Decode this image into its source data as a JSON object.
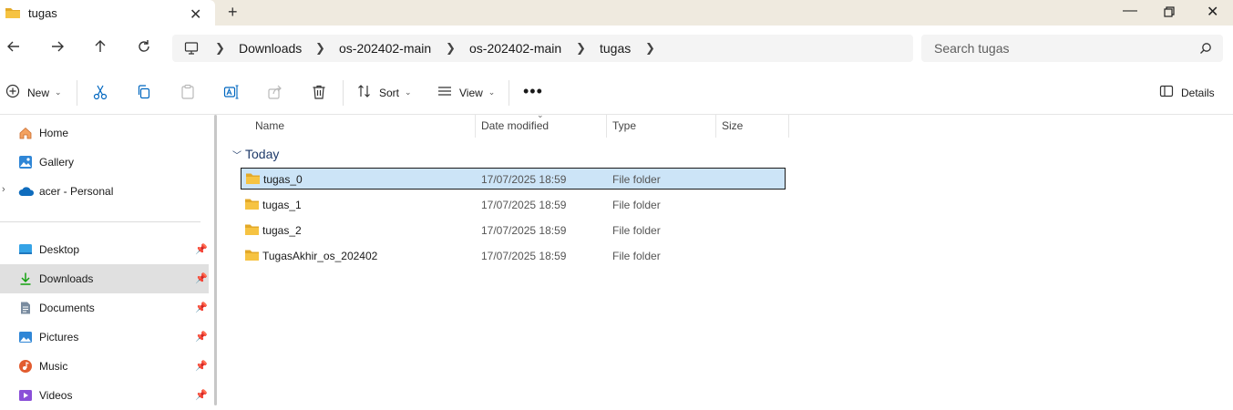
{
  "tab": {
    "title": "tugas",
    "close_icon": "close-icon",
    "new_tab_icon": "plus-icon"
  },
  "window": {
    "minimize": "minimize-icon",
    "maximize": "maximize-icon",
    "close": "close-icon"
  },
  "nav": {
    "back": "back-arrow-icon",
    "forward": "forward-arrow-icon",
    "up": "up-arrow-icon",
    "refresh": "refresh-icon"
  },
  "breadcrumb": {
    "root_icon": "computer-icon",
    "items": [
      "Downloads",
      "os-202402-main",
      "os-202402-main",
      "tugas"
    ]
  },
  "search": {
    "placeholder": "Search tugas"
  },
  "commands": {
    "new": "New",
    "cut": "cut-icon",
    "copy": "copy-icon",
    "paste": "paste-icon",
    "rename": "rename-icon",
    "share": "share-icon",
    "delete": "delete-icon",
    "sort": "Sort",
    "view": "View",
    "more": "more-icon",
    "details": "Details"
  },
  "sidebar": {
    "top_items": [
      {
        "label": "Home",
        "icon": "home-icon"
      },
      {
        "label": "Gallery",
        "icon": "gallery-icon"
      },
      {
        "label": "acer - Personal",
        "icon": "cloud-icon"
      }
    ],
    "pinned_items": [
      {
        "label": "Desktop",
        "icon": "desktop-icon"
      },
      {
        "label": "Downloads",
        "icon": "download-icon"
      },
      {
        "label": "Documents",
        "icon": "documents-icon"
      },
      {
        "label": "Pictures",
        "icon": "pictures-icon"
      },
      {
        "label": "Music",
        "icon": "music-icon"
      },
      {
        "label": "Videos",
        "icon": "videos-icon"
      }
    ],
    "active": "Downloads"
  },
  "columns": [
    "Name",
    "Date modified",
    "Type",
    "Size"
  ],
  "group": {
    "label": "Today"
  },
  "rows": [
    {
      "name": "tugas_0",
      "date": "17/07/2025 18:59",
      "type": "File folder",
      "selected": true
    },
    {
      "name": "tugas_1",
      "date": "17/07/2025 18:59",
      "type": "File folder",
      "selected": false
    },
    {
      "name": "tugas_2",
      "date": "17/07/2025 18:59",
      "type": "File folder",
      "selected": false
    },
    {
      "name": "TugasAkhir_os_202402",
      "date": "17/07/2025 18:59",
      "type": "File folder",
      "selected": false
    }
  ],
  "colors": {
    "folder": "#f6c342",
    "folder_dark": "#e3a928",
    "selected_bg": "#cce4f7",
    "accent": "#0067c0"
  }
}
